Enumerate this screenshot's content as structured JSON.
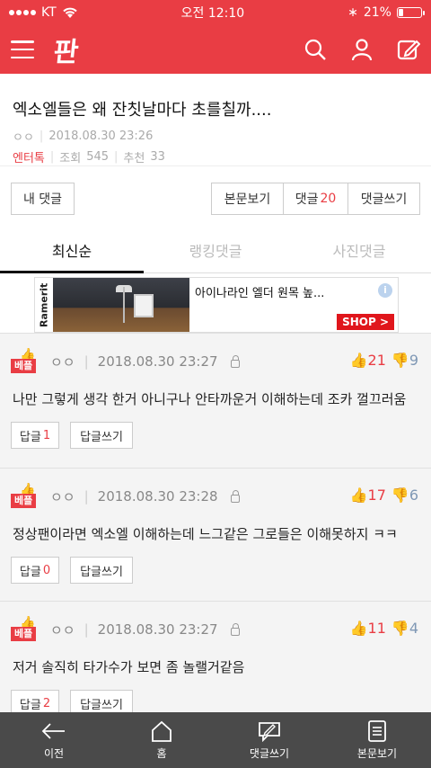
{
  "status": {
    "carrier": "KT",
    "time": "오전 12:10",
    "battery": "21%",
    "battery_level": 0.21
  },
  "header": {
    "logo": "판"
  },
  "post": {
    "title": "엑소엘들은 왜 잔칫날마다 초를칠까....",
    "author": "ㅇㅇ",
    "date": "2018.08.30 23:26",
    "category": "엔터톡",
    "views_label": "조회",
    "views": "545",
    "recommend_label": "추천",
    "recommend": "33"
  },
  "actions": {
    "my_comments": "내 댓글",
    "view_post": "본문보기",
    "comments_label": "댓글",
    "comments_count": "20",
    "write_comment": "댓글쓰기"
  },
  "tabs": [
    "최신순",
    "랭킹댓글",
    "사진댓글"
  ],
  "ad": {
    "brand": "Ramerit",
    "text": "아이나라인 엘더 원목 높...",
    "cta": "SHOP >",
    "info": "i"
  },
  "comments": [
    {
      "badge": "베플",
      "author": "ㅇㅇ",
      "date": "2018.08.30 23:27",
      "likes": "21",
      "dislikes": "9",
      "text": "나만 그렇게 생각 한거 아니구나 안타까운거 이해하는데 조카 껄끄러움",
      "reply_label": "답글",
      "reply_count": "1",
      "write_reply": "답글쓰기"
    },
    {
      "badge": "베플",
      "author": "ㅇㅇ",
      "date": "2018.08.30 23:28",
      "likes": "17",
      "dislikes": "6",
      "text": "정상팬이라면 엑소엘 이해하는데 느그같은 그로들은 이해못하지 ㅋㅋ",
      "reply_label": "답글",
      "reply_count": "0",
      "write_reply": "답글쓰기"
    },
    {
      "badge": "베플",
      "author": "ㅇㅇ",
      "date": "2018.08.30 23:27",
      "likes": "11",
      "dislikes": "4",
      "text": "저거 솔직히 타가수가 보면 좀 놀랠거같음",
      "reply_label": "답글",
      "reply_count": "2",
      "write_reply": "답글쓰기"
    }
  ],
  "bottom_nav": [
    {
      "label": "이전",
      "icon": "back-arrow-icon"
    },
    {
      "label": "홈",
      "icon": "home-icon"
    },
    {
      "label": "댓글쓰기",
      "icon": "write-comment-icon"
    },
    {
      "label": "본문보기",
      "icon": "document-icon"
    }
  ],
  "colors": {
    "brand": "#e93d44",
    "bottom_bar": "#4a4a4a",
    "dislike": "#7f98b5"
  }
}
